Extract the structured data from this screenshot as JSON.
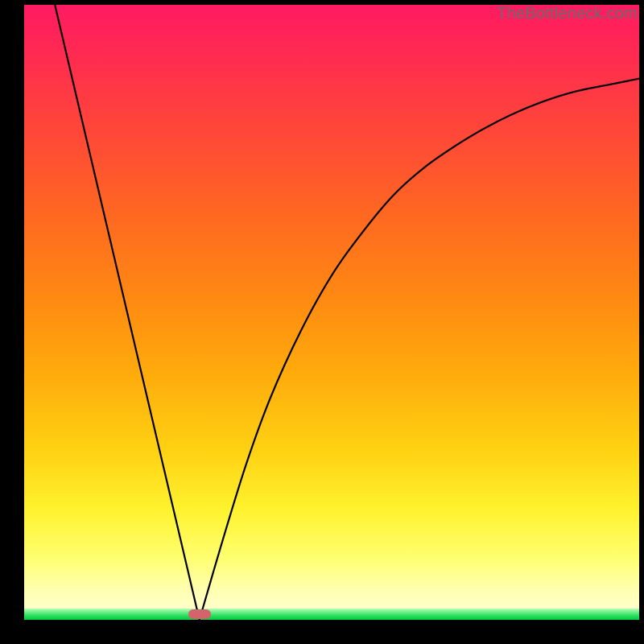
{
  "watermark": "TheBottleneck.com",
  "chart_data": {
    "type": "line",
    "title": "",
    "xlabel": "",
    "ylabel": "",
    "xlim": [
      0,
      100
    ],
    "ylim": [
      0,
      100
    ],
    "grid": false,
    "legend": false,
    "series": [
      {
        "name": "left-line",
        "x": [
          5,
          28.5
        ],
        "values": [
          100,
          0
        ]
      },
      {
        "name": "right-curve",
        "x": [
          28.5,
          32,
          36,
          40,
          45,
          50,
          55,
          60,
          65,
          70,
          75,
          80,
          85,
          90,
          95,
          100
        ],
        "values": [
          0,
          12,
          25,
          36,
          47,
          56,
          63,
          69,
          73.5,
          77,
          80,
          82.5,
          84.5,
          86,
          87,
          88
        ]
      }
    ],
    "marker": {
      "x": 28.5,
      "y": 0
    },
    "background_gradient": {
      "top": "#ff1a62",
      "bottom": "#ffffd8",
      "band": "#00c840"
    }
  }
}
